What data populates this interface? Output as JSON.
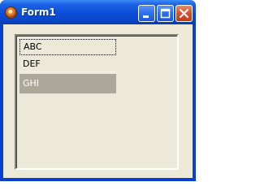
{
  "window": {
    "title": "Form1",
    "controls": {
      "minimize_icon": "minimize-icon",
      "maximize_icon": "maximize-icon",
      "close_icon": "close-icon"
    },
    "colors": {
      "titlebar": "#0a4ed8",
      "client_background": "#ece9d8",
      "selected_item": "#aca899"
    }
  },
  "listbox": {
    "items": [
      {
        "label": "ABC",
        "focused": true,
        "selected": false
      },
      {
        "label": "DEF",
        "focused": false,
        "selected": false
      },
      {
        "label": "GHI",
        "focused": false,
        "selected": true
      }
    ]
  }
}
